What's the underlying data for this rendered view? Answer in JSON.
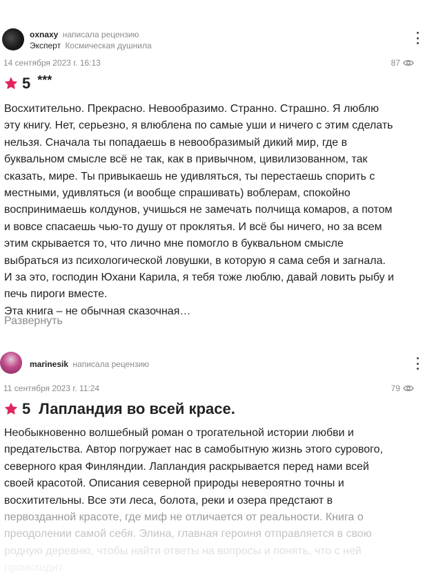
{
  "reviews": [
    {
      "author": "oxnaxy",
      "action": "написала рецензию",
      "expert_label": "Эксперт",
      "expert_title": "Космическая душнила",
      "date": "14 сентября 2023 г. 16:13",
      "views": "87",
      "rating": "5",
      "title": "***",
      "lines": [
        "Восхитительно. Прекрасно. Невообразимо. Странно. Страшно. Я люблю",
        "эту книгу. Нет, серьезно, я влюблена по самые уши и ничего с этим сделать",
        "нельзя. Сначала ты попадаешь в невообразимый дикий мир, где в",
        "буквальном смысле всё не так, как в привычном, цивилизованном, так",
        "сказать, мире. Ты привыкаешь не удивляться, ты перестаешь спорить с",
        "местными, удивляться (и вообще спрашивать) воблерам, спокойно",
        "воспринимаешь колдунов, учишься не замечать полчища комаров, а потом",
        "и вовсе спасаешь чью-то душу от проклятья. И всё бы ничего, но за всем",
        "этим скрывается то, что лично мне помогло в буквальном смысле",
        "выбраться из психологической ловушки, в которую я сама себя и загнала.",
        "И за это, господин Юхани Карила, я тебя тоже люблю, давай ловить рыбу и",
        "печь пироги вместе.",
        "Эта книга – не обычная сказочная…"
      ],
      "expand_label": "Развернуть"
    },
    {
      "author": "marinesik",
      "action": "написала рецензию",
      "date": "11 сентября 2023 г. 11:24",
      "views": "79",
      "rating": "5",
      "title": "Лапландия во всей красе.",
      "lines": [
        "Необыкновенно волшебный роман о трогательной истории любви и",
        "предательства. Автор погружает нас в самобытную жизнь этого сурового,",
        "северного края Финляндии. Лапландия раскрывается перед нами всей",
        "своей красотой. Описания северной природы невероятно точны и",
        "восхитительны. Все эти леса, болота, реки и озера предстают в",
        "первозданной красоте, где миф не отличается от реальности. Книга о",
        "преодолении самой себя. Элина, главная героиня отправляется в свою",
        "родную деревню, чтобы найти ответы на вопросы и понять, что с ней",
        "происходит."
      ]
    }
  ],
  "colors": {
    "star": "#e0245e",
    "muted": "#8a8a8a",
    "text": "#222222"
  },
  "icons": {
    "star": "star-icon",
    "eye": "eye-icon",
    "more": "more-vertical-icon"
  }
}
